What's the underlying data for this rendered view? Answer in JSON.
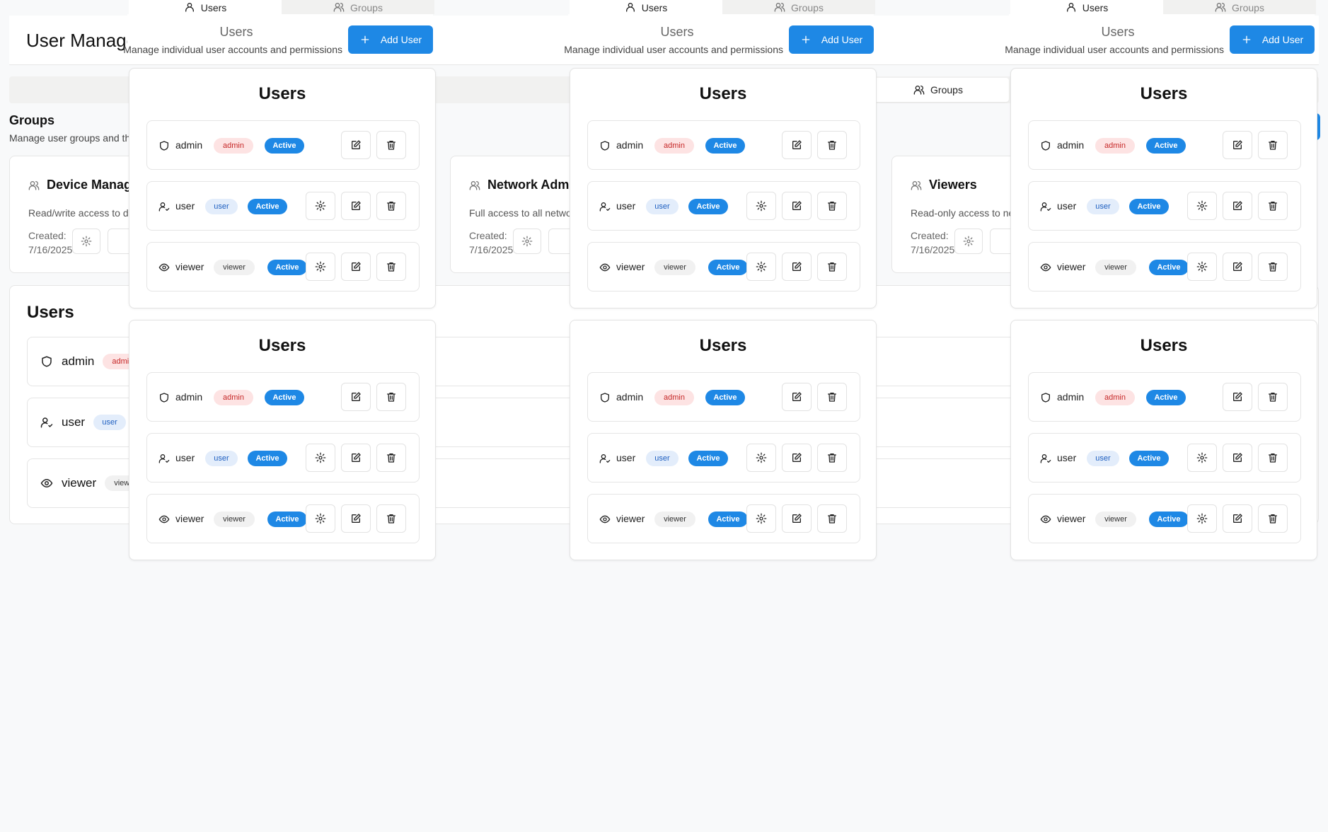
{
  "base": {
    "title": "User Management",
    "tab_groups_label": "Groups",
    "groups_title": "Groups",
    "groups_subtitle": "Manage user groups and their permissions",
    "group_cards": [
      {
        "name": "Device Managers",
        "description": "Read/write access to device management",
        "created_label": "Created:",
        "created_date": "7/16/2025"
      },
      {
        "name": "Network Administrators",
        "description": "Full access to all network resources",
        "created_label": "Created:",
        "created_date": "7/16/2025"
      },
      {
        "name": "Viewers",
        "description": "Read-only access to network resources",
        "created_label": "Created:",
        "created_date": "7/16/2025"
      }
    ],
    "users_title": "Users",
    "users": [
      {
        "name": "admin",
        "role": "admin"
      },
      {
        "name": "user",
        "role": "user"
      },
      {
        "name": "viewer",
        "role": "viewer"
      }
    ]
  },
  "overlay": {
    "tab_users": "Users",
    "tab_groups": "Groups",
    "header_title": "Users",
    "header_subtitle": "Manage individual user accounts and permissions",
    "add_user_label": "Add User",
    "panel_title": "Users",
    "users": [
      {
        "name": "admin",
        "role": "admin",
        "status": "Active"
      },
      {
        "name": "user",
        "role": "user",
        "status": "Active"
      },
      {
        "name": "viewer",
        "role": "viewer",
        "status": "Active"
      }
    ]
  },
  "colors": {
    "accent": "#1e88e5",
    "admin_badge": "#fde3e3",
    "user_badge": "#e3edfb",
    "viewer_badge": "#f1f1f1"
  }
}
